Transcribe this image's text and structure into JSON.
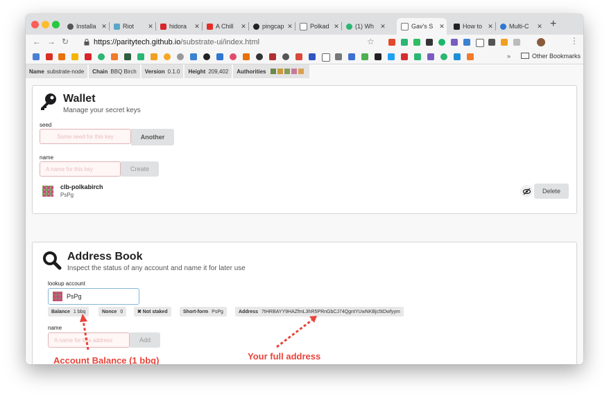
{
  "browser": {
    "tabs": [
      {
        "title": "Installa",
        "color": "#555555"
      },
      {
        "title": "Riot",
        "color": "#5aa6c8"
      },
      {
        "title": "hidora",
        "color": "#d8242b"
      },
      {
        "title": "A Chill",
        "color": "#e52d27"
      },
      {
        "title": "pingcap",
        "color": "#222222"
      },
      {
        "title": "Polkad",
        "color": "#888888"
      },
      {
        "title": "(1) Wh",
        "color": "#2bb673"
      },
      {
        "title": "Gav's S",
        "color": "#888888"
      },
      {
        "title": "How to",
        "color": "#222222"
      },
      {
        "title": "Multi-C",
        "color": "#2f77d0"
      }
    ],
    "url_host": "https://paritytech.github.io",
    "url_path": "/substrate-ui/index.html",
    "bookmarks_more": "»",
    "bookmarks_other": "Other Bookmarks"
  },
  "status": [
    {
      "key": "Name",
      "value": "substrate-node"
    },
    {
      "key": "Chain",
      "value": "BBQ Birch"
    },
    {
      "key": "Version",
      "value": "0.1.0"
    },
    {
      "key": "Height",
      "value": "209,402"
    },
    {
      "key": "Authorities",
      "value": ""
    }
  ],
  "wallet": {
    "title": "Wallet",
    "subtitle": "Manage your secret keys",
    "seed_label": "seed",
    "seed_placeholder": "Some seed for this key",
    "another_button": "Another",
    "name_label": "name",
    "name_placeholder": "A name for this key",
    "create_button": "Create",
    "account_name": "clb-polkabirch",
    "account_short": "PsPg",
    "delete_button": "Delete"
  },
  "address_book": {
    "title": "Address Book",
    "subtitle": "Inspect the status of any account and name it for later use",
    "lookup_label": "lookup account",
    "lookup_value": "PsPg",
    "tags": {
      "balance_key": "Balance",
      "balance_value": "1 bbq",
      "nonce_key": "Nonce",
      "nonce_value": "0",
      "not_staked": "✖ Not staked",
      "shortform_key": "Short-form",
      "shortform_value": "PsPg",
      "address_key": "Address",
      "address_value": "7tHRBAYY9HAZfmL3hR5PRnGbCJ74QgntYUwNKBjc5tDwfyym"
    },
    "name_label": "name",
    "name_placeholder": "A name for this address",
    "add_button": "Add"
  },
  "annotations": {
    "balance": "Account Balance (1 bbq)",
    "address": "Your full address"
  },
  "colors": {
    "annotation": "#e8433a",
    "error_bg": "#fff6f6",
    "error_border": "#e0b4b4"
  }
}
